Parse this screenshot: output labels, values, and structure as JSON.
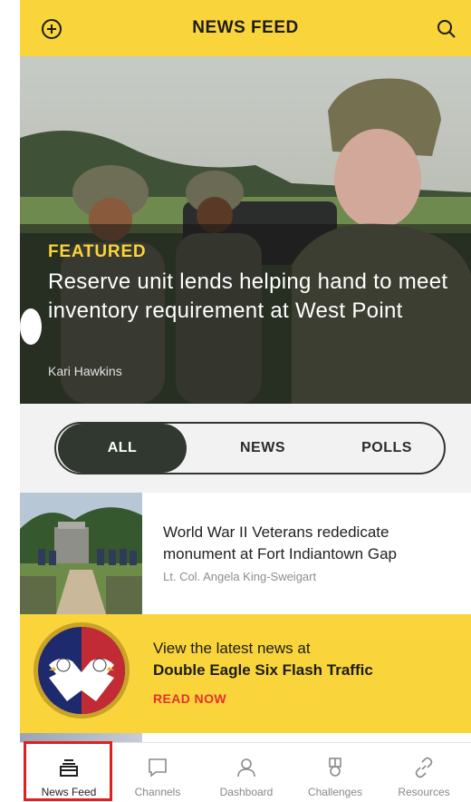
{
  "header": {
    "title": "NEWS FEED",
    "left_icon": "add-circle-icon",
    "right_icon": "search-icon"
  },
  "hero": {
    "kicker": "FEATURED",
    "title": "Reserve unit lends helping hand to meet inventory requirement at West Point",
    "author": "Kari Hawkins"
  },
  "filters": {
    "tabs": [
      {
        "label": "ALL",
        "selected": true
      },
      {
        "label": "NEWS",
        "selected": false
      },
      {
        "label": "POLLS",
        "selected": false
      }
    ]
  },
  "articles": [
    {
      "title": "World War II Veterans rededicate monument at Fort Indiantown Gap",
      "author": "Lt. Col. Angela King-Sweigart"
    }
  ],
  "promo": {
    "line1": "View the latest news at",
    "line2": "Double Eagle Six Flash Traffic",
    "cta": "READ NOW"
  },
  "tabbar": {
    "items": [
      {
        "label": "News Feed",
        "icon": "news-feed-icon",
        "active": true
      },
      {
        "label": "Channels",
        "icon": "chat-bubble-icon",
        "active": false
      },
      {
        "label": "Dashboard",
        "icon": "person-icon",
        "active": false
      },
      {
        "label": "Challenges",
        "icon": "medal-icon",
        "active": false
      },
      {
        "label": "Resources",
        "icon": "link-icon",
        "active": false
      }
    ]
  },
  "colors": {
    "accent_yellow": "#f9d43a",
    "dark_green": "#303830",
    "cta_red": "#e5312b",
    "highlight_red": "#e02020"
  }
}
